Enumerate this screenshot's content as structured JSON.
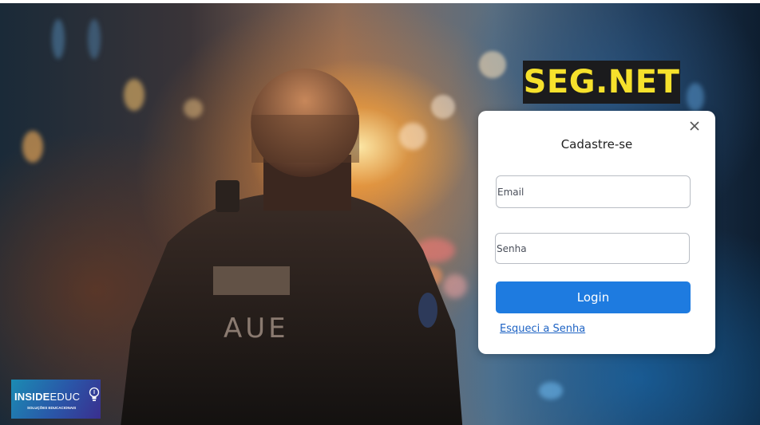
{
  "brand": {
    "title": "SEG.NET"
  },
  "modal": {
    "title": "Cadastre-se",
    "close_icon": "close-icon",
    "email": {
      "placeholder": "Email",
      "value": ""
    },
    "password": {
      "placeholder": "Senha",
      "value": ""
    },
    "login_label": "Login",
    "forgot_label": "Esqueci a Senha"
  },
  "background": {
    "patch_text": "AUE"
  },
  "logo": {
    "bold": "INSIDE",
    "light": "EDUC",
    "tagline": "SOLUÇÕES EDUCACIONAIS",
    "icon": "lightbulb-icon"
  },
  "colors": {
    "brand_yellow": "#f6e12c",
    "brand_bg": "#1b1b1d",
    "button_blue": "#1e7be0",
    "link_blue": "#1e63c4"
  }
}
